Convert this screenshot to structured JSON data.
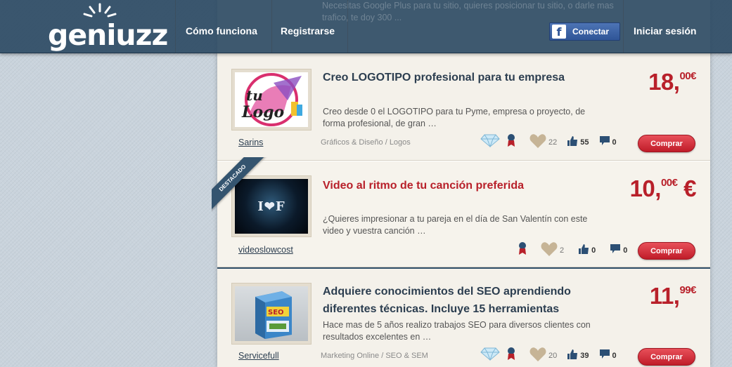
{
  "header": {
    "logo_text": "geniuzz",
    "nav": {
      "how_it_works": "Cómo funciona",
      "register": "Registrarse",
      "login": "Iniciar sesión"
    },
    "facebook_button": "Conectar",
    "behind_text": "Necesitas Google Plus para tu sitio, quieres posicionar tu sitio, o darle mas trafico, te doy 300 ..."
  },
  "listings": [
    {
      "title": "Creo LOGOTIPO profesional para tu empresa",
      "description": "Creo desde 0 el LOGOTIPO para tu Pyme, empresa o proyecto, de forma profesional, de gran …",
      "price_int": "18,",
      "price_dec": "00€",
      "seller": "Sarins",
      "category": "Gráficos & Diseño / Logos",
      "favorites": "22",
      "likes": "55",
      "comments": "0",
      "buy_label": "Comprar",
      "thumb_text": "tu Logo"
    },
    {
      "badge": "DESTACADO",
      "title": "Video al ritmo de tu canción preferida",
      "description": "¿Quieres impresionar a tu pareja en el día de San Valentín con este video y vuestra canción …",
      "price_int": "10,",
      "price_dec": "00€",
      "price_suffix": " €",
      "seller": "videoslowcost",
      "favorites": "2",
      "likes": "0",
      "comments": "0",
      "buy_label": "Comprar",
      "thumb_text": "I❤F"
    },
    {
      "title": "Adquiere conocimientos del SEO aprendiendo diferentes técnicas. Incluye 15 herramientas",
      "description": "Hace mas de 5 años realizo trabajos SEO para diversos clientes con resultados excelentes en …",
      "price_int": "11,",
      "price_dec": "99€",
      "seller": "Servicefull",
      "category": "Marketing Online / SEO & SEM",
      "favorites": "20",
      "likes": "39",
      "comments": "0",
      "buy_label": "Comprar",
      "thumb_text": "SEO SECRETO REVELADO"
    }
  ],
  "colors": {
    "header": "#2a4862",
    "accent_red": "#b8202a",
    "panel": "#f4f1ea"
  }
}
